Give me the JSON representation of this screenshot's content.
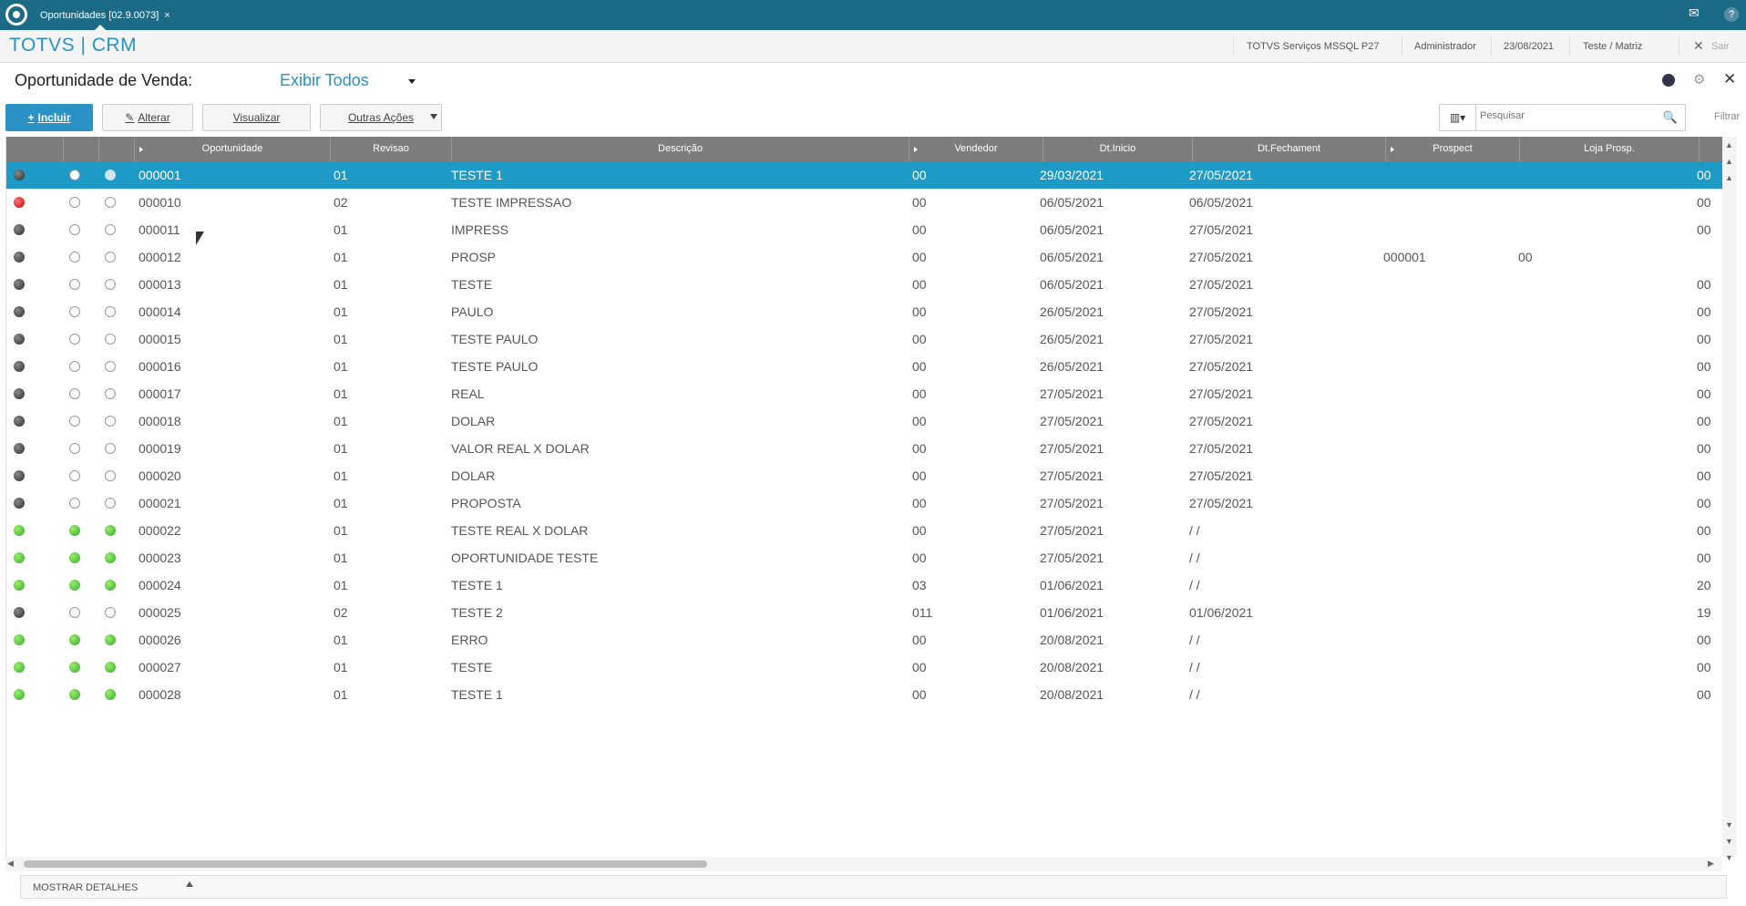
{
  "window": {
    "tab_label": "Oportunidades [02.9.0073]",
    "tab_close": "×"
  },
  "topbar_icons": [
    "mail-icon",
    "help-icon"
  ],
  "header": {
    "brand": "TOTVS | CRM",
    "environment": "TOTVS Serviços MSSQL P27",
    "user": "Administrador",
    "date": "23/08/2021",
    "branch": "Teste / Matriz",
    "logout_label": "Sair"
  },
  "page": {
    "title": "Oportunidade de Venda:",
    "view_filter": "Exibir Todos"
  },
  "toolbar": {
    "incluir_label": "Incluir",
    "alterar_label": "Alterar",
    "visualizar_label": "Visualizar",
    "outras_label": "Outras Ações",
    "search_placeholder": "Pesquisar",
    "filtrar_label": "Filtrar"
  },
  "grid": {
    "columns": [
      "Oportunidade",
      "Revisao",
      "Descrição",
      "Vendedor",
      "Dt.Inicio",
      "Dt.Fechament",
      "Prospect",
      "Loja Prosp."
    ],
    "rows": [
      {
        "status": "dark",
        "c2": "empty",
        "c3": "ltblue",
        "op": "000001",
        "rev": "01",
        "desc": "TESTE 1",
        "vend": "00",
        "ini": "29/03/2021",
        "fech": "27/05/2021",
        "prosp": "",
        "loja": "",
        "end": "00",
        "selected": true
      },
      {
        "status": "red",
        "c2": "empty",
        "c3": "empty",
        "op": "000010",
        "rev": "02",
        "desc": "TESTE IMPRESSAO",
        "vend": "00",
        "ini": "06/05/2021",
        "fech": "06/05/2021",
        "prosp": "",
        "loja": "",
        "end": "00"
      },
      {
        "status": "dark",
        "c2": "empty",
        "c3": "empty",
        "op": "000011",
        "rev": "01",
        "desc": "IMPRESS",
        "vend": "00",
        "ini": "06/05/2021",
        "fech": "27/05/2021",
        "prosp": "",
        "loja": "",
        "end": "00"
      },
      {
        "status": "dark",
        "c2": "empty",
        "c3": "empty",
        "op": "000012",
        "rev": "01",
        "desc": "PROSP",
        "vend": "00",
        "ini": "06/05/2021",
        "fech": "27/05/2021",
        "prosp": "000001",
        "loja": "00",
        "end": ""
      },
      {
        "status": "dark",
        "c2": "empty",
        "c3": "empty",
        "op": "000013",
        "rev": "01",
        "desc": "TESTE",
        "vend": "00",
        "ini": "06/05/2021",
        "fech": "27/05/2021",
        "prosp": "",
        "loja": "",
        "end": "00"
      },
      {
        "status": "dark",
        "c2": "empty",
        "c3": "empty",
        "op": "000014",
        "rev": "01",
        "desc": "PAULO",
        "vend": "00",
        "ini": "26/05/2021",
        "fech": "27/05/2021",
        "prosp": "",
        "loja": "",
        "end": "00"
      },
      {
        "status": "dark",
        "c2": "empty",
        "c3": "empty",
        "op": "000015",
        "rev": "01",
        "desc": "TESTE PAULO",
        "vend": "00",
        "ini": "26/05/2021",
        "fech": "27/05/2021",
        "prosp": "",
        "loja": "",
        "end": "00"
      },
      {
        "status": "dark",
        "c2": "empty",
        "c3": "empty",
        "op": "000016",
        "rev": "01",
        "desc": "TESTE PAULO",
        "vend": "00",
        "ini": "26/05/2021",
        "fech": "27/05/2021",
        "prosp": "",
        "loja": "",
        "end": "00"
      },
      {
        "status": "dark",
        "c2": "empty",
        "c3": "empty",
        "op": "000017",
        "rev": "01",
        "desc": "REAL",
        "vend": "00",
        "ini": "27/05/2021",
        "fech": "27/05/2021",
        "prosp": "",
        "loja": "",
        "end": "00"
      },
      {
        "status": "dark",
        "c2": "empty",
        "c3": "empty",
        "op": "000018",
        "rev": "01",
        "desc": "DOLAR",
        "vend": "00",
        "ini": "27/05/2021",
        "fech": "27/05/2021",
        "prosp": "",
        "loja": "",
        "end": "00"
      },
      {
        "status": "dark",
        "c2": "empty",
        "c3": "empty",
        "op": "000019",
        "rev": "01",
        "desc": "VALOR REAL X DOLAR",
        "vend": "00",
        "ini": "27/05/2021",
        "fech": "27/05/2021",
        "prosp": "",
        "loja": "",
        "end": "00"
      },
      {
        "status": "dark",
        "c2": "empty",
        "c3": "empty",
        "op": "000020",
        "rev": "01",
        "desc": "DOLAR",
        "vend": "00",
        "ini": "27/05/2021",
        "fech": "27/05/2021",
        "prosp": "",
        "loja": "",
        "end": "00"
      },
      {
        "status": "dark",
        "c2": "empty",
        "c3": "empty",
        "op": "000021",
        "rev": "01",
        "desc": "PROPOSTA",
        "vend": "00",
        "ini": "27/05/2021",
        "fech": "27/05/2021",
        "prosp": "",
        "loja": "",
        "end": "00"
      },
      {
        "status": "green",
        "c2": "green",
        "c3": "green",
        "op": "000022",
        "rev": "01",
        "desc": "TESTE REAL X DOLAR",
        "vend": "00",
        "ini": "27/05/2021",
        "fech": "  /  /",
        "prosp": "",
        "loja": "",
        "end": "00"
      },
      {
        "status": "green",
        "c2": "green",
        "c3": "green",
        "op": "000023",
        "rev": "01",
        "desc": "OPORTUNIDADE TESTE",
        "vend": "00",
        "ini": "27/05/2021",
        "fech": "  /  /",
        "prosp": "",
        "loja": "",
        "end": "00"
      },
      {
        "status": "green",
        "c2": "green",
        "c3": "green",
        "op": "000024",
        "rev": "01",
        "desc": "TESTE 1",
        "vend": "03",
        "ini": "01/06/2021",
        "fech": "  /  /",
        "prosp": "",
        "loja": "",
        "end": "20"
      },
      {
        "status": "dark",
        "c2": "empty",
        "c3": "empty",
        "op": "000025",
        "rev": "02",
        "desc": "TESTE 2",
        "vend": "011",
        "ini": "01/06/2021",
        "fech": "01/06/2021",
        "prosp": "",
        "loja": "",
        "end": "19"
      },
      {
        "status": "green",
        "c2": "green",
        "c3": "green",
        "op": "000026",
        "rev": "01",
        "desc": "ERRO",
        "vend": "00",
        "ini": "20/08/2021",
        "fech": "  /  /",
        "prosp": "",
        "loja": "",
        "end": "00"
      },
      {
        "status": "green",
        "c2": "green",
        "c3": "green",
        "op": "000027",
        "rev": "01",
        "desc": "TESTE",
        "vend": "00",
        "ini": "20/08/2021",
        "fech": "  /  /",
        "prosp": "",
        "loja": "",
        "end": "00"
      },
      {
        "status": "green",
        "c2": "green",
        "c3": "green",
        "op": "000028",
        "rev": "01",
        "desc": "TESTE 1",
        "vend": "00",
        "ini": "20/08/2021",
        "fech": "  /  /",
        "prosp": "",
        "loja": "",
        "end": "00"
      }
    ]
  },
  "footer": {
    "details_label": "MOSTRAR DETALHES"
  },
  "colors": {
    "topbar": "#1b6a86",
    "accent": "#2a92c5",
    "selected_row": "#1d9ac6",
    "header_gray": "#7d7d7d"
  }
}
